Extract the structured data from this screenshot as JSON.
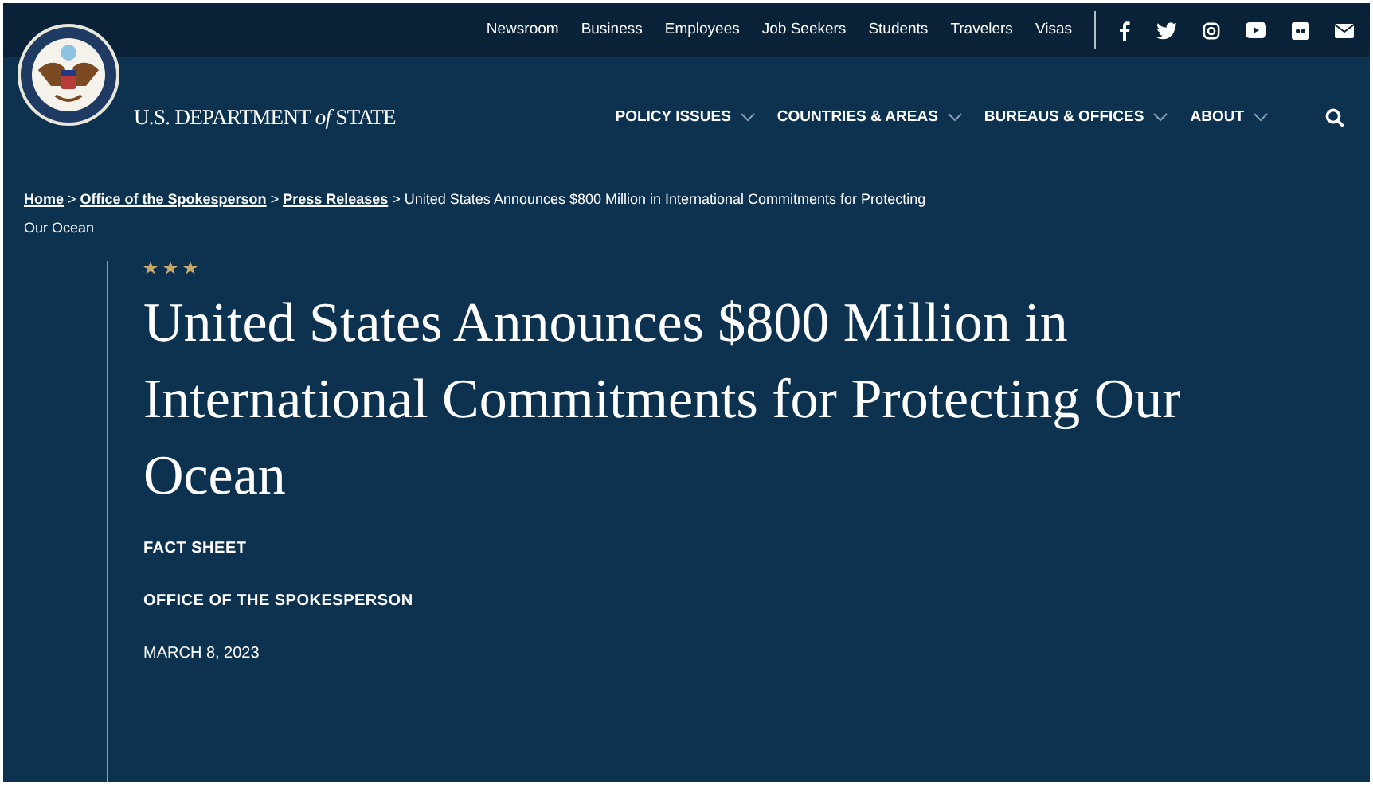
{
  "top_links": [
    "Newsroom",
    "Business",
    "Employees",
    "Job Seekers",
    "Students",
    "Travelers",
    "Visas"
  ],
  "site_name": "U.S. DEPARTMENT *of* STATE",
  "nav": [
    "POLICY ISSUES",
    "COUNTRIES & AREAS",
    "BUREAUS & OFFICES",
    "ABOUT"
  ],
  "breadcrumb": {
    "separator": ">",
    "links": [
      "Home",
      "Office of the Spokesperson",
      "Press Releases"
    ],
    "current": "United States Announces $800 Million in International Commitments for Protecting Our Ocean"
  },
  "title": "United States Announces $800 Million in International Commitments for Protecting Our Ocean",
  "content_type": "FACT SHEET",
  "author": "OFFICE OF THE SPOKESPERSON",
  "date": "MARCH 8, 2023"
}
